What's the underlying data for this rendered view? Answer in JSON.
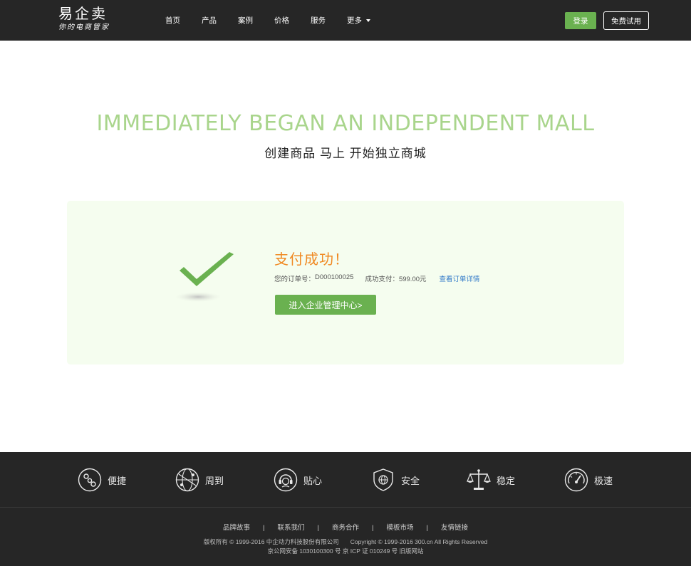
{
  "header": {
    "logo_main": "易企卖",
    "logo_sub": "你的电商管家",
    "nav": [
      "首页",
      "产品",
      "案例",
      "价格",
      "服务"
    ],
    "nav_more": "更多",
    "login_label": "登录",
    "trial_label": "免费试用"
  },
  "hero": {
    "title_en": "IMMEDIATELY BEGAN AN INDEPENDENT MALL",
    "title_cn": "创建商品 马上 开始独立商城"
  },
  "success": {
    "title": "支付成功！",
    "order_label": "您的订单号：",
    "order_no": "D000100025",
    "paid_label": "成功支付：",
    "paid_amount": "599.00元",
    "detail_link": "查看订单详情",
    "enter_button": "进入企业管理中心>"
  },
  "footer": {
    "features": [
      {
        "label": "便捷",
        "icon": "link-chain-icon"
      },
      {
        "label": "周到",
        "icon": "globe-network-icon"
      },
      {
        "label": "贴心",
        "icon": "headset-support-icon"
      },
      {
        "label": "安全",
        "icon": "shield-globe-icon"
      },
      {
        "label": "稳定",
        "icon": "balance-scale-icon"
      },
      {
        "label": "极速",
        "icon": "speedometer-icon"
      }
    ],
    "links": [
      "品牌故事",
      "联系我们",
      "商务合作",
      "模板市场",
      "友情链接"
    ],
    "link_separator": "|",
    "copyright_cn": "版权所有 © 1999-2016 中企动力科技股份有限公司",
    "copyright_en": "Copyright © 1999-2016 300.cn All Rights Reserved",
    "icp": "京公网安备 1030100300 号 京 ICP 证 010249 号 旧版网站"
  },
  "colors": {
    "accent_green": "#6ab150",
    "hero_green": "#a9d58c",
    "success_orange": "#f08a24",
    "link_blue": "#2f78c8",
    "header_bg": "#262626",
    "panel_bg": "#f5fdef"
  }
}
